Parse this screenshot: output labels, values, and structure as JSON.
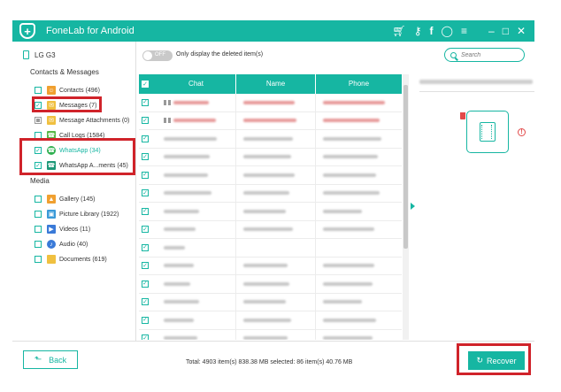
{
  "app": {
    "title": "FoneLab for Android",
    "title_icons": [
      "cart-icon",
      "key-icon",
      "facebook-icon",
      "chat-icon",
      "menu-icon",
      "minimize-icon",
      "maximize-icon",
      "close-icon"
    ]
  },
  "device": {
    "name": "LG G3"
  },
  "sidebar": {
    "contacts_messages_title": "Contacts & Messages",
    "media_title": "Media",
    "items": [
      {
        "label": "Contacts (496)",
        "checked": false,
        "icon": "contacts-icon",
        "color": "#f0a030"
      },
      {
        "label": "Messages (7)",
        "checked": true,
        "icon": "messages-icon",
        "color": "#f0c040"
      },
      {
        "label": "Message Attachments (0)",
        "checked": "partial",
        "icon": "attachment-icon",
        "color": "#f0c040"
      },
      {
        "label": "Call Logs (1584)",
        "checked": false,
        "icon": "phone-icon",
        "color": "#58b848"
      },
      {
        "label": "WhatsApp (34)",
        "checked": true,
        "icon": "whatsapp-icon",
        "color": "#30b050"
      },
      {
        "label": "WhatsApp A...ments (45)",
        "checked": true,
        "icon": "whatsapp-attachment-icon",
        "color": "#1e9878"
      },
      {
        "label": "Gallery (145)",
        "checked": false,
        "icon": "gallery-icon",
        "color": "#f0a030"
      },
      {
        "label": "Picture Library (1922)",
        "checked": false,
        "icon": "picture-library-icon",
        "color": "#3a9ad8"
      },
      {
        "label": "Videos (11)",
        "checked": false,
        "icon": "video-icon",
        "color": "#3a7ad8"
      },
      {
        "label": "Audio (40)",
        "checked": false,
        "icon": "audio-icon",
        "color": "#3a7ad8"
      },
      {
        "label": "Documents (619)",
        "checked": false,
        "icon": "folder-icon",
        "color": "#f0c040"
      }
    ]
  },
  "toolbar": {
    "toggle_label": "OFF",
    "toggle_text": "Only display the deleted item(s)",
    "search_placeholder": "Search"
  },
  "table": {
    "headers": [
      "Chat",
      "Name",
      "Phone"
    ],
    "rows": [
      {
        "checked": true,
        "deleted": true
      },
      {
        "checked": true,
        "deleted": true
      },
      {
        "checked": true,
        "deleted": false
      },
      {
        "checked": true,
        "deleted": false
      },
      {
        "checked": true,
        "deleted": false
      },
      {
        "checked": true,
        "deleted": false
      },
      {
        "checked": true,
        "deleted": false
      },
      {
        "checked": true,
        "deleted": false
      },
      {
        "checked": true,
        "deleted": false
      },
      {
        "checked": true,
        "deleted": false
      },
      {
        "checked": true,
        "deleted": false
      },
      {
        "checked": true,
        "deleted": false
      },
      {
        "checked": true,
        "deleted": false
      },
      {
        "checked": true,
        "deleted": false
      }
    ]
  },
  "footer": {
    "back_label": "Back",
    "status": "Total: 4903 item(s) 838.38 MB   selected: 86 item(s) 40.76 MB",
    "recover_label": "Recover"
  },
  "colors": {
    "accent": "#16b6a2",
    "highlight": "#d0232a"
  }
}
